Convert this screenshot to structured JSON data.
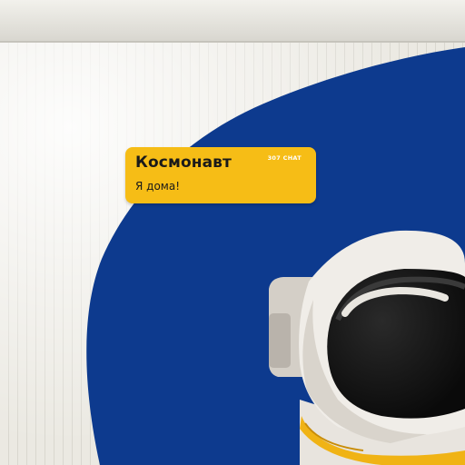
{
  "chat": {
    "sender_name": "Космонавт",
    "channel_label": "307 CHAT",
    "message_text": "Я дома!"
  },
  "colors": {
    "bubble": "#f6bd16",
    "mural_blue": "#0d3a8e",
    "wall": "#eceae3",
    "helmet_trim": "#f0b315"
  },
  "icons": {
    "astronaut": "astronaut-mural"
  }
}
